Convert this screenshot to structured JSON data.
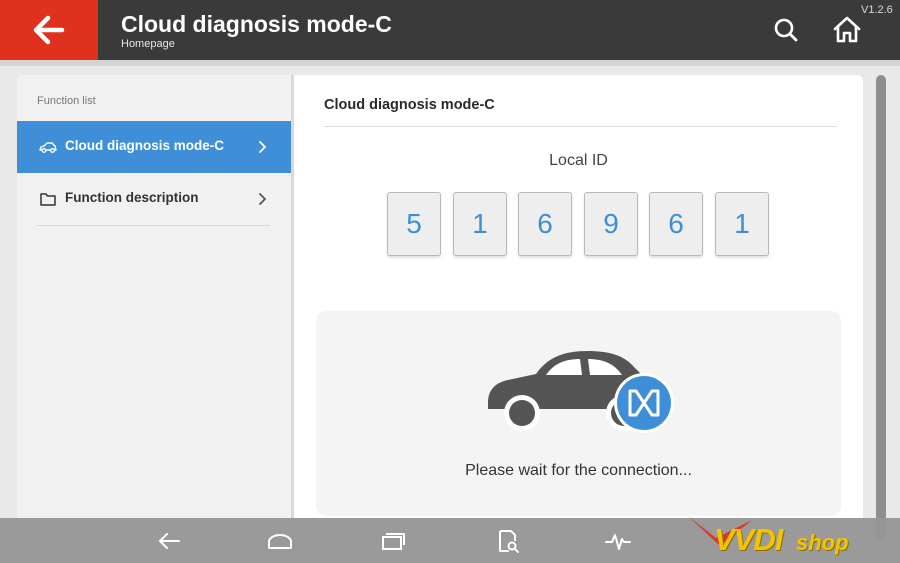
{
  "header": {
    "title": "Cloud diagnosis mode-C",
    "subtitle": "Homepage",
    "version": "V1.2.6",
    "icons": [
      "back-arrow-icon",
      "search-icon",
      "home-icon"
    ]
  },
  "sidebar": {
    "label": "Function list",
    "items": [
      {
        "label": "Cloud diagnosis mode-C",
        "icon": "car-icon",
        "active": true
      },
      {
        "label": "Function description",
        "icon": "folder-icon",
        "active": false
      }
    ]
  },
  "main": {
    "title": "Cloud diagnosis mode-C",
    "local_id_label": "Local ID",
    "local_id_digits": [
      "5",
      "1",
      "6",
      "9",
      "6",
      "1"
    ],
    "wait_message": "Please wait for the connection..."
  },
  "navbar": {
    "icons": [
      "nav-back-icon",
      "nav-home-icon",
      "nav-recents-icon",
      "nav-search-doc-icon",
      "nav-pulse-icon"
    ]
  },
  "watermark": {
    "brand": "VVDI",
    "suffix": "shop"
  },
  "colors": {
    "header_bg": "#3a3a3a",
    "back_button": "#e0301e",
    "accent_blue": "#3f8fd8"
  }
}
